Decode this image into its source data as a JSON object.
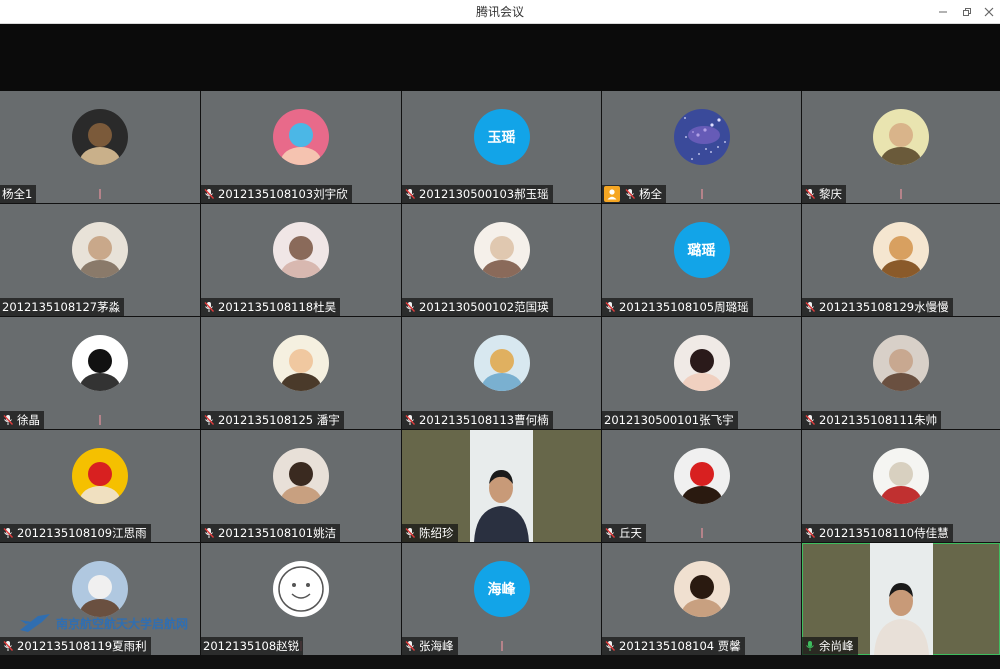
{
  "window": {
    "title": "腾讯会议",
    "controls": [
      "minimize",
      "restore",
      "close"
    ]
  },
  "colors": {
    "tile_bg": "#686c6e",
    "video_bg": "#67674a",
    "avatar_text_bg": "#12a4e8",
    "active_border": "#3ebd5e",
    "host_badge": "#f5a623"
  },
  "participants": [
    {
      "name": "杨全1",
      "mic": "none",
      "avatar": "photo-guitarist",
      "voice": true
    },
    {
      "name": "2012135108103刘宇欣",
      "mic": "muted",
      "avatar": "photo-sunglasses"
    },
    {
      "name": "2012130500103郝玉瑶",
      "mic": "muted",
      "avatar_text": "玉瑶"
    },
    {
      "name": "杨全",
      "mic": "muted",
      "host": true,
      "avatar": "photo-galaxy",
      "voice": true
    },
    {
      "name": "黎庆",
      "mic": "muted",
      "avatar": "photo-glasses-man",
      "voice": true
    },
    {
      "name": "2012135108127茅淼",
      "mic": "none",
      "avatar": "photo-family"
    },
    {
      "name": "2012135108118杜昊",
      "mic": "muted",
      "avatar": "photo-anime-girl"
    },
    {
      "name": "2012130500102范国瑛",
      "mic": "muted",
      "avatar": "photo-puppy"
    },
    {
      "name": "2012135108105周璐瑶",
      "mic": "muted",
      "avatar_text": "璐瑶"
    },
    {
      "name": "2012135108129水慢慢",
      "mic": "muted",
      "avatar": "photo-cartoon-dog"
    },
    {
      "name": "徐晶",
      "mic": "muted",
      "avatar": "photo-dark",
      "voice": true
    },
    {
      "name": "2012135108125 潘宇",
      "mic": "muted",
      "avatar": "photo-child"
    },
    {
      "name": "2012135108113曹何楠",
      "mic": "muted",
      "avatar": "photo-doge"
    },
    {
      "name": "2012130500101张飞宇",
      "mic": "none",
      "avatar": "photo-girl"
    },
    {
      "name": "2012135108111朱帅",
      "mic": "muted",
      "avatar": "photo-man"
    },
    {
      "name": "2012135108109江思雨",
      "mic": "muted",
      "avatar": "photo-tiger-cartoon"
    },
    {
      "name": "2012135108101姚洁",
      "mic": "muted",
      "avatar": "photo-lying-boy"
    },
    {
      "name": "陈绍珍",
      "mic": "muted",
      "video": true
    },
    {
      "name": "丘天",
      "mic": "muted",
      "avatar": "photo-boy-back",
      "voice": true
    },
    {
      "name": "2012135108110侍佳慧",
      "mic": "muted",
      "avatar": "photo-sketch"
    },
    {
      "name": "2012135108119夏雨利",
      "mic": "muted",
      "avatar": "photo-cap-man"
    },
    {
      "name": "2012135108赵锐",
      "mic": "none",
      "avatar": "photo-smiley",
      "voice": true
    },
    {
      "name": "张海峰",
      "mic": "muted",
      "avatar_text": "海峰",
      "voice": true
    },
    {
      "name": "2012135108104 贾馨",
      "mic": "muted",
      "avatar": "photo-beach-girl"
    },
    {
      "name": "余尚峰",
      "mic": "active",
      "video": true,
      "active": true
    }
  ],
  "watermark": {
    "text": "南京航空航天大学启航网"
  }
}
